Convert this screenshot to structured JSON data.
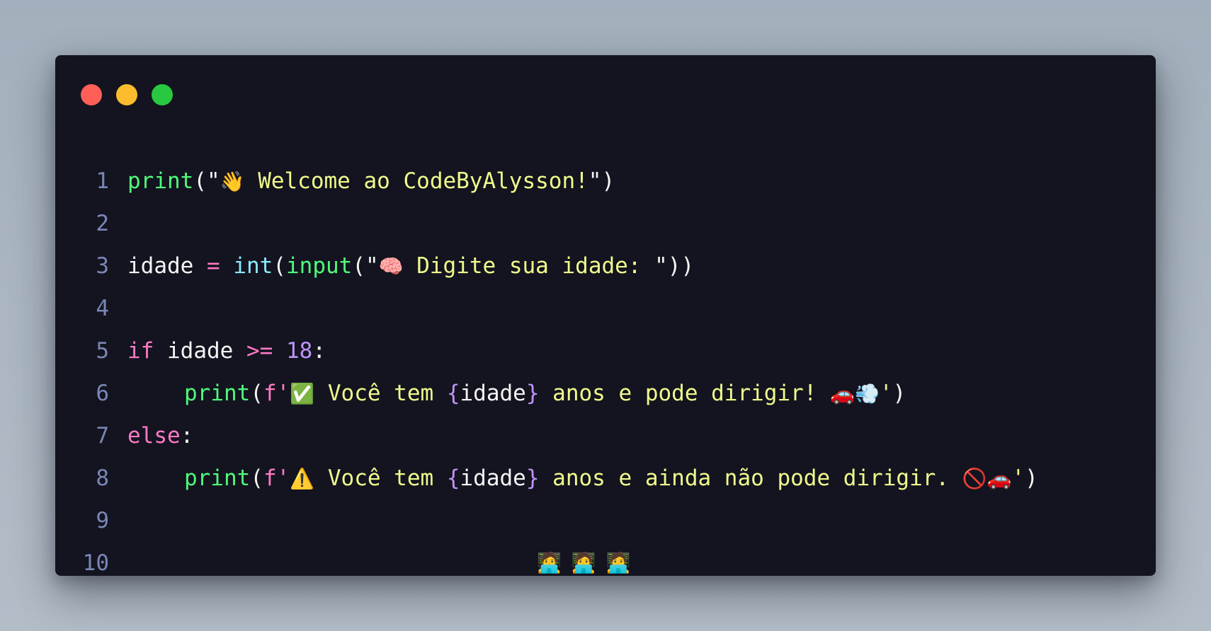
{
  "window": {
    "controls": [
      {
        "name": "close",
        "color": "#fe5f57"
      },
      {
        "name": "minimize",
        "color": "#fdbc2e"
      },
      {
        "name": "maximize",
        "color": "#28c840"
      }
    ]
  },
  "code": {
    "lines": [
      {
        "number": "1",
        "tokens": [
          {
            "cls": "fn",
            "text": "print"
          },
          {
            "cls": "punc",
            "text": "(\""
          },
          {
            "cls": "emoji",
            "text": "👋"
          },
          {
            "cls": "str",
            "text": " Welcome ao CodeByAlysson!"
          },
          {
            "cls": "punc",
            "text": "\")"
          }
        ]
      },
      {
        "number": "2",
        "tokens": []
      },
      {
        "number": "3",
        "tokens": [
          {
            "cls": "var",
            "text": "idade "
          },
          {
            "cls": "op",
            "text": "="
          },
          {
            "cls": "var",
            "text": " "
          },
          {
            "cls": "builtin",
            "text": "int"
          },
          {
            "cls": "punc",
            "text": "("
          },
          {
            "cls": "fn",
            "text": "input"
          },
          {
            "cls": "punc",
            "text": "(\""
          },
          {
            "cls": "emoji",
            "text": "🧠"
          },
          {
            "cls": "str",
            "text": " Digite sua idade: "
          },
          {
            "cls": "punc",
            "text": "\"))"
          }
        ]
      },
      {
        "number": "4",
        "tokens": []
      },
      {
        "number": "5",
        "tokens": [
          {
            "cls": "kw",
            "text": "if"
          },
          {
            "cls": "var",
            "text": " idade "
          },
          {
            "cls": "op",
            "text": ">="
          },
          {
            "cls": "var",
            "text": " "
          },
          {
            "cls": "num",
            "text": "18"
          },
          {
            "cls": "punc",
            "text": ":"
          }
        ]
      },
      {
        "number": "6",
        "indent": true,
        "tokens": [
          {
            "cls": "fn",
            "text": "print"
          },
          {
            "cls": "punc",
            "text": "("
          },
          {
            "cls": "kw",
            "text": "f'"
          },
          {
            "cls": "emoji",
            "text": "✅"
          },
          {
            "cls": "str",
            "text": " Você tem "
          },
          {
            "cls": "brace",
            "text": "{"
          },
          {
            "cls": "var",
            "text": "idade"
          },
          {
            "cls": "brace",
            "text": "}"
          },
          {
            "cls": "str",
            "text": " anos e pode dirigir! "
          },
          {
            "cls": "emoji",
            "text": "🚗💨"
          },
          {
            "cls": "str",
            "text": "'"
          },
          {
            "cls": "punc",
            "text": ")"
          }
        ]
      },
      {
        "number": "7",
        "tokens": [
          {
            "cls": "kw",
            "text": "else"
          },
          {
            "cls": "punc",
            "text": ":"
          }
        ]
      },
      {
        "number": "8",
        "indent": true,
        "tokens": [
          {
            "cls": "fn",
            "text": "print"
          },
          {
            "cls": "punc",
            "text": "("
          },
          {
            "cls": "kw",
            "text": "f'"
          },
          {
            "cls": "emoji",
            "text": "⚠️"
          },
          {
            "cls": "str",
            "text": " Você tem "
          },
          {
            "cls": "brace",
            "text": "{"
          },
          {
            "cls": "var",
            "text": "idade"
          },
          {
            "cls": "brace",
            "text": "}"
          },
          {
            "cls": "str",
            "text": " anos e ainda não pode dirigir. "
          },
          {
            "cls": "emoji",
            "text": "🚫🚗"
          },
          {
            "cls": "str",
            "text": "'"
          },
          {
            "cls": "punc",
            "text": ")"
          }
        ]
      },
      {
        "number": "9",
        "tokens": []
      },
      {
        "number": "10",
        "tokens": [],
        "footer_emoji": "🧑‍💻🧑‍💻🧑‍💻"
      }
    ]
  }
}
